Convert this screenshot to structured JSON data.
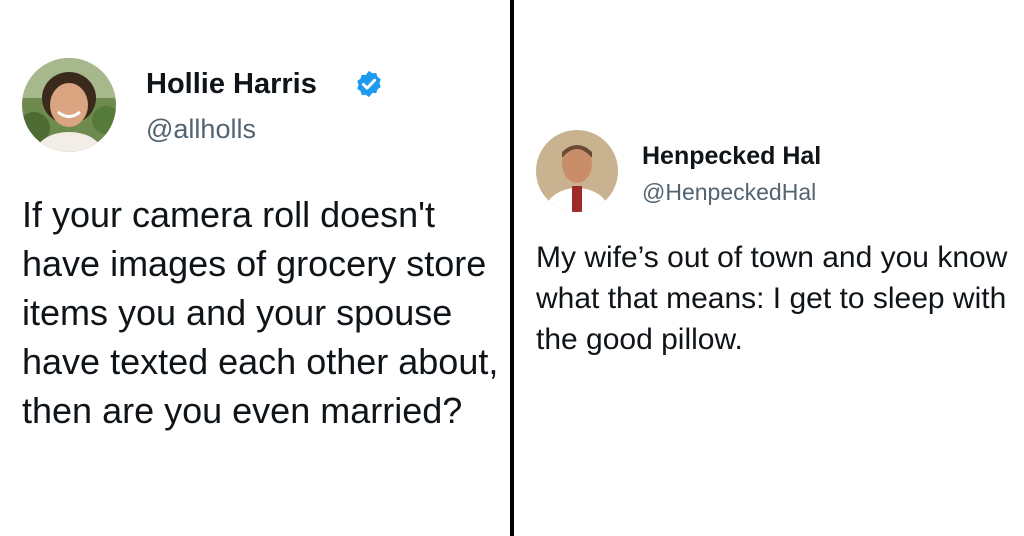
{
  "colors": {
    "background": "#ffffff",
    "text": "#0f1419",
    "handle": "#536471",
    "verified_badge": "#1d9bf0",
    "divider": "#000000"
  },
  "tweets": [
    {
      "name": "Hollie Harris",
      "handle": "@allholls",
      "verified": true,
      "verified_icon": "verified-badge-icon",
      "text": "If your camera roll doesn't have images of grocery store items you and your spouse have texted each other about, then are you even married?"
    },
    {
      "name": "Henpecked Hal",
      "handle": "@HenpeckedHal",
      "verified": false,
      "text": "My wife’s out of town and you know what that means: I get to sleep with the good pillow."
    }
  ]
}
